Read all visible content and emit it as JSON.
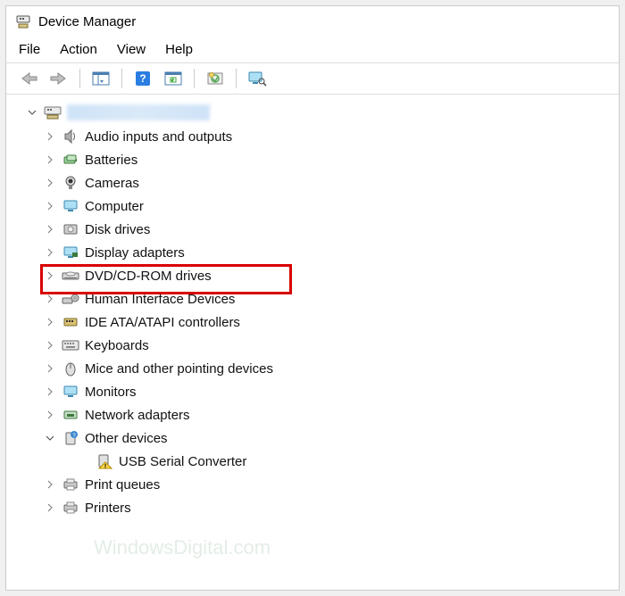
{
  "window": {
    "title": "Device Manager"
  },
  "menu": {
    "file": "File",
    "action": "Action",
    "view": "View",
    "help": "Help"
  },
  "tree": {
    "root_label": "(computer name)",
    "nodes": [
      {
        "label": "Audio inputs and outputs",
        "expanded": false
      },
      {
        "label": "Batteries",
        "expanded": false
      },
      {
        "label": "Cameras",
        "expanded": false
      },
      {
        "label": "Computer",
        "expanded": false
      },
      {
        "label": "Disk drives",
        "expanded": false
      },
      {
        "label": "Display adapters",
        "expanded": false
      },
      {
        "label": "DVD/CD-ROM drives",
        "expanded": false,
        "highlighted": true
      },
      {
        "label": "Human Interface Devices",
        "expanded": false
      },
      {
        "label": "IDE ATA/ATAPI controllers",
        "expanded": false
      },
      {
        "label": "Keyboards",
        "expanded": false
      },
      {
        "label": "Mice and other pointing devices",
        "expanded": false
      },
      {
        "label": "Monitors",
        "expanded": false
      },
      {
        "label": "Network adapters",
        "expanded": false
      },
      {
        "label": "Other devices",
        "expanded": true,
        "children": [
          {
            "label": "USB Serial Converter",
            "warning": true
          }
        ]
      },
      {
        "label": "Print queues",
        "expanded": false
      },
      {
        "label": "Printers",
        "expanded": false
      }
    ]
  },
  "watermark": "WindowsDigital.com"
}
